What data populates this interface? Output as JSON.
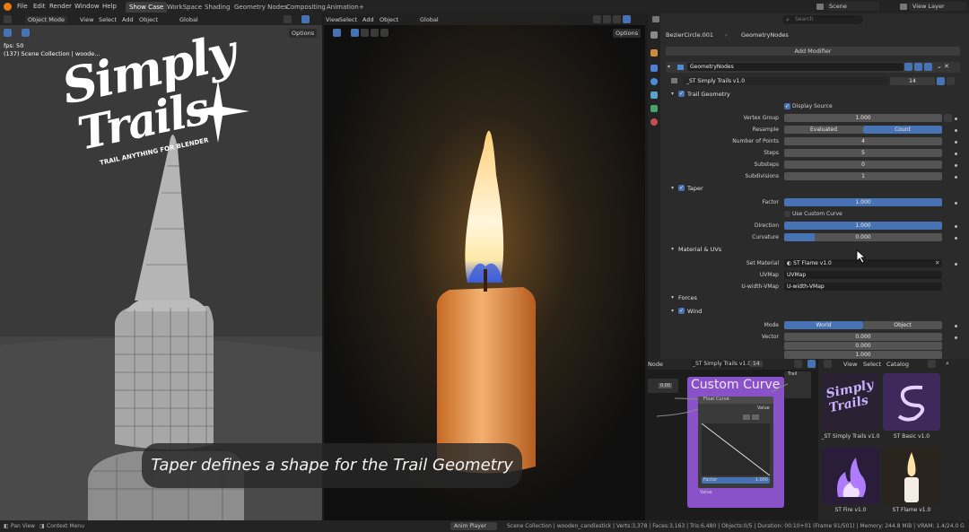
{
  "topbar": {
    "menus": [
      "File",
      "Edit",
      "Render",
      "Window",
      "Help"
    ],
    "tabs": [
      "Show Case",
      "WorkSpace",
      "Shading",
      "Geometry Nodes",
      "Compositing",
      "Animation"
    ],
    "add_tab": "+",
    "scene_label": "Scene",
    "view_layer_label": "View Layer"
  },
  "viewport_left": {
    "mode": "Object Mode",
    "menus": [
      "View",
      "Select",
      "Add",
      "Object"
    ],
    "transform": "Global",
    "options": "Options",
    "fps": "fps: 50",
    "collection": "(137) Scene Collection | woode..."
  },
  "viewport_mid": {
    "menus": [
      "View",
      "Select",
      "Add",
      "Object"
    ],
    "transform": "Global",
    "options": "Options"
  },
  "logo": {
    "line1": "Simply",
    "line2": "Trails",
    "tagline": "TRAIL ANYTHING FOR BLENDER"
  },
  "subtitle": "Taper defines a shape for the Trail Geometry",
  "properties": {
    "search_placeholder": "Search",
    "breadcrumb_object": "BezierCircle.001",
    "breadcrumb_modifier": "GeometryNodes",
    "add_modifier": "Add Modifier",
    "modifier_name": "GeometryNodes",
    "node_group": "_ST Simply Trails v1.0",
    "node_group_users": "14",
    "panels": {
      "trail_geometry": "Trail Geometry",
      "display_source": "Display Source",
      "vertex_group_label": "Vertex Group",
      "vertex_group_value": "1.000",
      "resample_label": "Resample",
      "resample_opt1": "Evaluated",
      "resample_opt2": "Count",
      "num_points_label": "Number of Points",
      "num_points_value": "4",
      "steps_label": "Steps",
      "steps_value": "5",
      "substeps_label": "Substeps",
      "substeps_value": "0",
      "subdivisions_label": "Subdivisions",
      "subdivisions_value": "1",
      "taper": "Taper",
      "factor_label": "Factor",
      "factor_value": "1.000",
      "use_custom_curve": "Use Custom Curve",
      "direction_label": "Direction",
      "direction_value": "1.000",
      "curvature_label": "Curvature",
      "curvature_value": "0.000",
      "material_uvs": "Material & UVs",
      "set_material_label": "Set Material",
      "set_material_value": "ST Flame v1.0",
      "uvmap_label": "UVMap",
      "uvmap_value": "UVMap",
      "uwidth_label": "U-width-VMap",
      "uwidth_value": "U-width-VMap",
      "forces": "Forces",
      "wind": "Wind",
      "mode_label": "Mode",
      "mode_opt1": "World",
      "mode_opt2": "Object",
      "vector_label": "Vector",
      "vector_x": "0.000",
      "vector_y": "0.000",
      "vector_z": "1.000"
    }
  },
  "node_editor": {
    "label": "Node",
    "group": "_ST Simply Trails v1.0",
    "users": "14",
    "frame_title": "Custom Curve",
    "socket_top": "Trail",
    "socket_value": "Value",
    "socket_curve": "Float Curve",
    "socket_factor": "Factor",
    "factor_value": "1.000",
    "socket_out": "Value",
    "small_value": "0.00"
  },
  "asset_browser": {
    "menus": [
      "View",
      "Select",
      "Catalog"
    ],
    "items": [
      "_ST Simply Trails v1.0",
      "ST Basic v1.0",
      "ST Fire v1.0",
      "ST Flame v1.0"
    ]
  },
  "statusbar": {
    "pan_view": "Pan View",
    "context_menu": "Context Menu",
    "player": "Anim Player",
    "info": "Scene Collection | wooden_candlestick | Verts:3,378 | Faces:3,163 | Tris:6,480 | Objects:0/5 | Duration: 00:10+01 (Frame 91/501) | Memory: 244.8 MiB | VRAM: 1.4/24.0 GiB | 4.1.0"
  },
  "colors": {
    "accent": "#4772b3",
    "node_frame": "#8a52c9",
    "panel": "#2b2b2b"
  }
}
